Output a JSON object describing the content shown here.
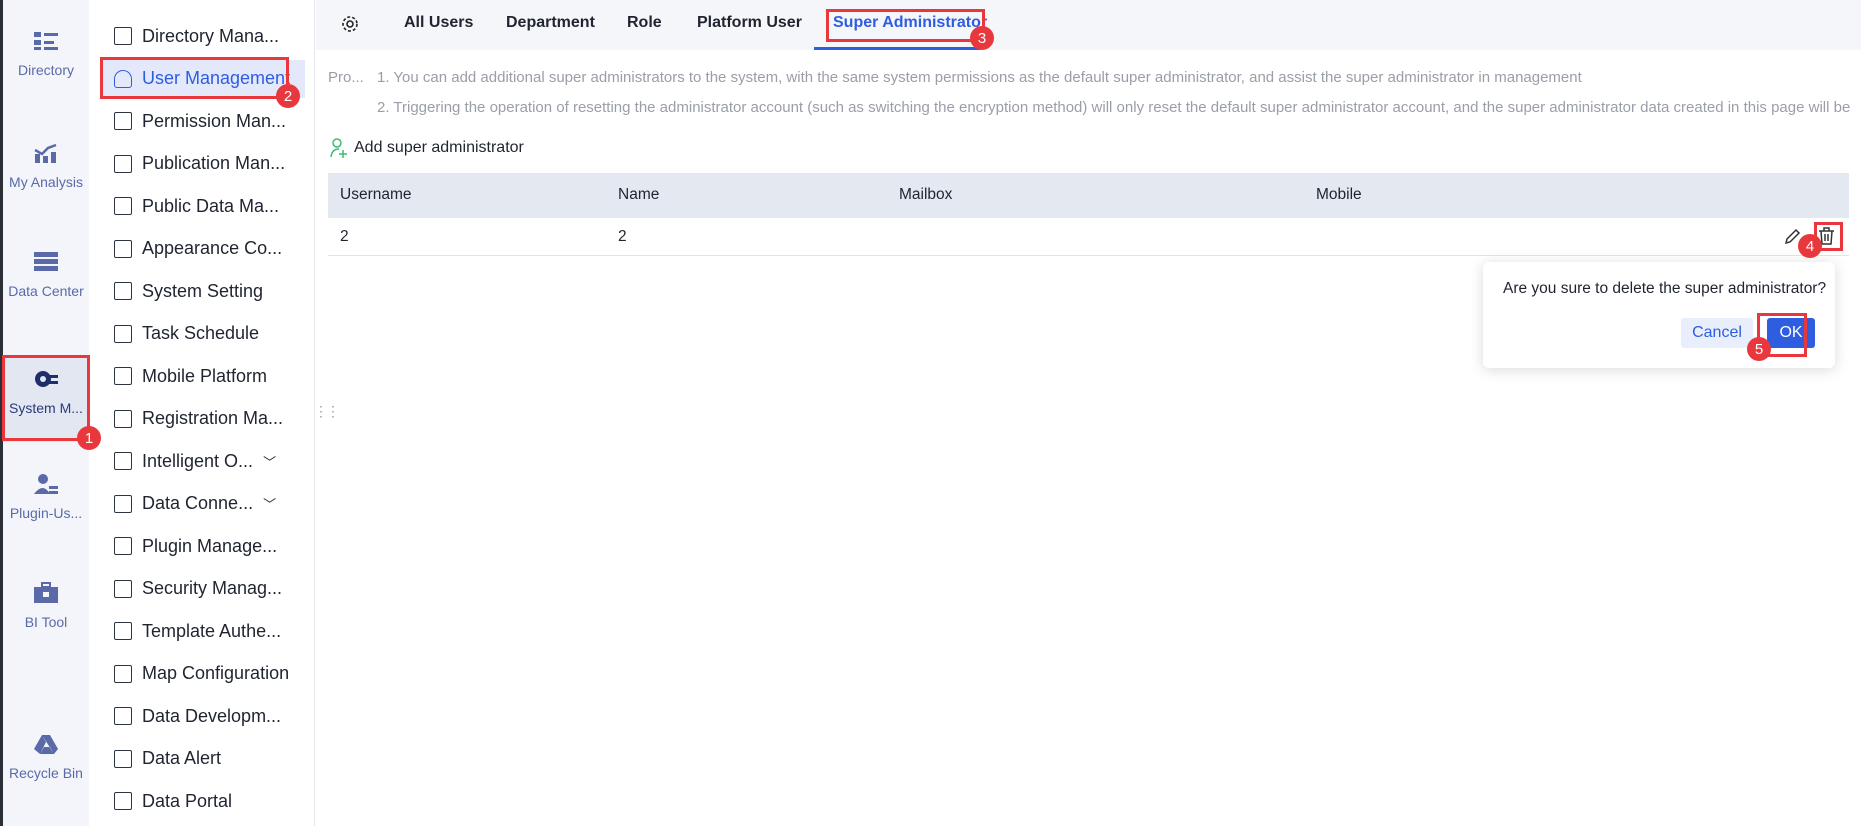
{
  "rail": [
    {
      "label": "Directory",
      "icon": "directory-icon"
    },
    {
      "label": "My Analysis",
      "icon": "analysis-icon"
    },
    {
      "label": "Data Center",
      "icon": "data-center-icon"
    },
    {
      "label": "System M...",
      "icon": "system-gear-icon"
    },
    {
      "label": "Plugin-Us...",
      "icon": "plugin-user-icon"
    },
    {
      "label": "BI Tool",
      "icon": "toolbox-icon"
    },
    {
      "label": "Recycle Bin",
      "icon": "recycle-icon"
    }
  ],
  "sidebar": [
    "Directory Mana...",
    "User Management",
    "Permission Man...",
    "Publication Man...",
    "Public Data Ma...",
    "Appearance Co...",
    "System Setting",
    "Task Schedule",
    "Mobile Platform",
    "Registration Ma...",
    "Intelligent O...",
    "Data Conne...",
    "Plugin Manage...",
    "Security Manag...",
    "Template Authe...",
    "Map Configuration",
    "Data Developm...",
    "Data Alert",
    "Data Portal"
  ],
  "tabs": [
    "All Users",
    "Department",
    "Role",
    "Platform User",
    "Super Administrator"
  ],
  "tips": {
    "prefix": "Pro...",
    "line1": "1. You can add additional super administrators to the system, with the same system permissions as the default super administrator, and assist the super administrator in management",
    "line2": "2. Triggering the operation of resetting the administrator account (such as switching the encryption method) will only reset the default super administrator account, and the super administrator data created in this page will be"
  },
  "add_label": "Add super administrator",
  "table": {
    "headers": [
      "Username",
      "Name",
      "Mailbox",
      "Mobile"
    ],
    "rows": [
      [
        "2",
        "2",
        "",
        ""
      ]
    ]
  },
  "popconfirm": {
    "question": "Are you sure to delete the super administrator?",
    "cancel": "Cancel",
    "ok": "OK"
  },
  "badges": [
    "1",
    "2",
    "3",
    "4",
    "5"
  ],
  "colors": {
    "accent": "#2f5de0",
    "annotation": "#e8383d"
  }
}
